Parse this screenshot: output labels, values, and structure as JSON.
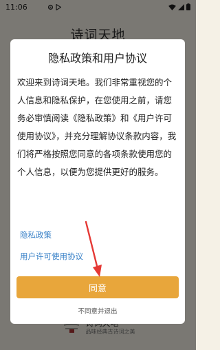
{
  "status_bar": {
    "time": "11:06",
    "icons": [
      "gear-icon",
      "play-store-icon",
      "wifi-icon",
      "signal-icon",
      "battery-icon"
    ]
  },
  "background": {
    "page_title": "诗词天地",
    "footer_name": "诗词天地",
    "footer_slogan": "品味经典古诗词之美"
  },
  "dialog": {
    "title": "隐私政策和用户协议",
    "body": "欢迎来到诗词天地。我们非常重视您的个人信息和隐私保护，在您使用之前，请您务必审慎阅读《隐私政策》和《用户许可使用协议》，并充分理解协议条款内容，我们将严格按照您同意的各项条款使用您的个人信息，以便为您提供更好的服务。",
    "privacy_link": "隐私政策",
    "agreement_link": "用户许可使用协议",
    "agree_label": "同意",
    "disagree_label": "不同意并退出"
  },
  "colors": {
    "accent": "#e8a63b",
    "link": "#3a82c8",
    "annotation_arrow": "#e53935"
  }
}
